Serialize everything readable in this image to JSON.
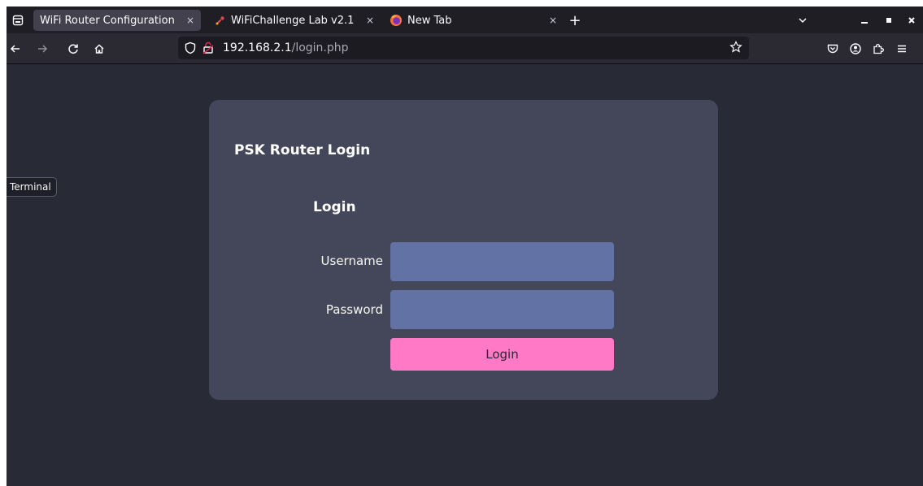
{
  "tabs": [
    {
      "title": "WiFi Router Configuration",
      "active": true,
      "icon": "none"
    },
    {
      "title": "WiFiChallenge Lab v2.1",
      "active": false,
      "icon": "wifichallenge-icon"
    },
    {
      "title": "New Tab",
      "active": false,
      "icon": "firefox-icon"
    }
  ],
  "tab_close_glyph": "×",
  "new_tab_glyph": "+",
  "url": {
    "host": "192.168.2.1",
    "path": "/login.php"
  },
  "sidebar_tooltip": "Terminal",
  "page": {
    "card_title": "PSK Router Login",
    "form_title": "Login",
    "username_label": "Username",
    "password_label": "Password",
    "username_value": "",
    "password_value": "",
    "submit_label": "Login"
  },
  "colors": {
    "page_bg": "#282a36",
    "card_bg": "#44475a",
    "input_bg": "#6272a4",
    "button_bg": "#ff79c6"
  }
}
